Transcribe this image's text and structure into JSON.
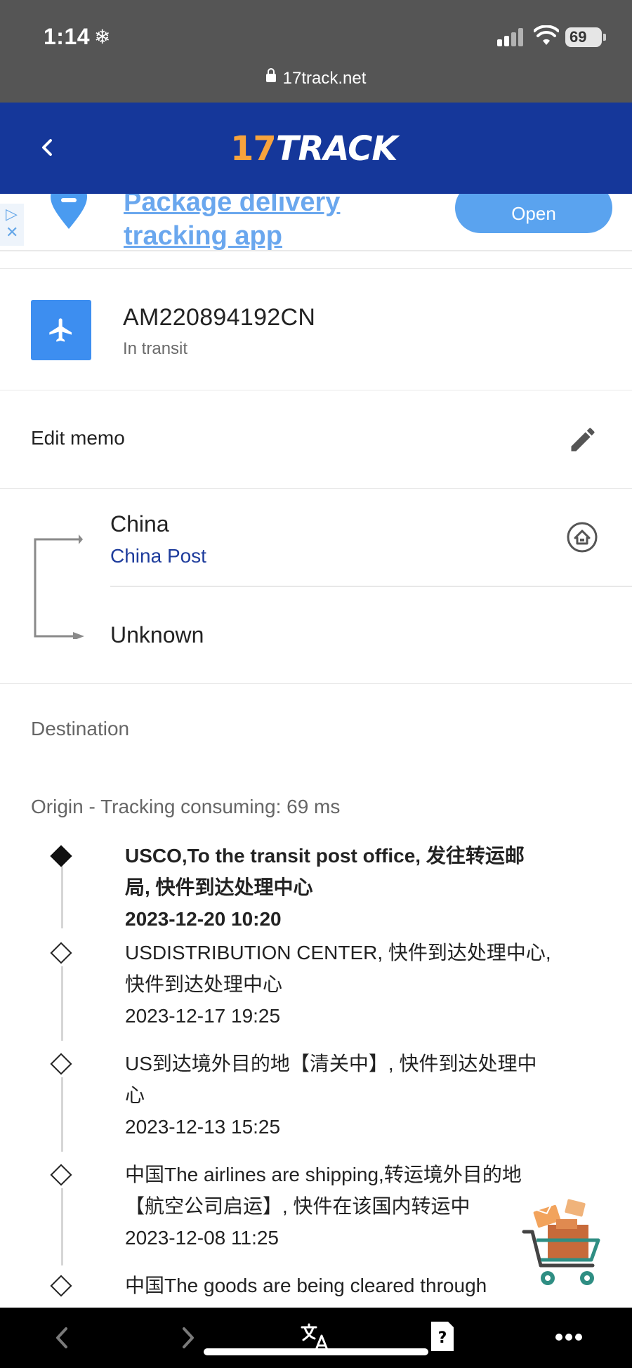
{
  "status_bar": {
    "time": "1:14",
    "battery": "69"
  },
  "browser": {
    "url": "17track.net"
  },
  "header": {
    "logo_number": "17",
    "logo_text": "TRACK"
  },
  "ad": {
    "title_line1": "Package delivery",
    "title_line2": "tracking app",
    "open_label": "Open"
  },
  "package": {
    "tracking_number": "AM220894192CN",
    "status": "In transit"
  },
  "memo": {
    "label": "Edit memo"
  },
  "route": {
    "origin_country": "China",
    "carrier": "China Post",
    "destination_country": "Unknown"
  },
  "sections": {
    "destination_label": "Destination",
    "origin_label": "Origin - Tracking consuming: 69 ms"
  },
  "events": [
    {
      "lines": [
        "USCO,To the transit post office, 发往转运邮",
        "局, 快件到达处理中心",
        "2023-12-20 10:20"
      ],
      "latest": true
    },
    {
      "lines": [
        "USDISTRIBUTION CENTER, 快件到达处理中心,",
        "快件到达处理中心",
        "2023-12-17 19:25"
      ],
      "latest": false
    },
    {
      "lines": [
        "US到达境外目的地【清关中】, 快件到达处理中",
        "心",
        "2023-12-13 15:25"
      ],
      "latest": false
    },
    {
      "lines": [
        "中国The airlines are shipping,转运境外目的地",
        "【航空公司启运】, 快件在该国内转运中",
        "2023-12-08 11:25"
      ],
      "latest": false
    },
    {
      "lines": [
        "中国The goods are being cleared through"
      ],
      "latest": false
    }
  ],
  "icons": {
    "status_weather": "snowflake-icon",
    "back": "chevron-left-icon",
    "transport": "airplane-icon",
    "edit": "pencil-icon",
    "origin_home": "home-circle-icon",
    "nav_back": "chevron-left-icon",
    "nav_forward": "chevron-right-icon",
    "translate": "translate-icon",
    "help": "help-icon",
    "more": "more-icon"
  },
  "colors": {
    "header_bg": "#15379a",
    "logo_accent": "#f7a33d",
    "carrier_link": "#1e3c9c",
    "plane_box": "#3d8ef0",
    "ad_button": "#5aa3ef"
  }
}
